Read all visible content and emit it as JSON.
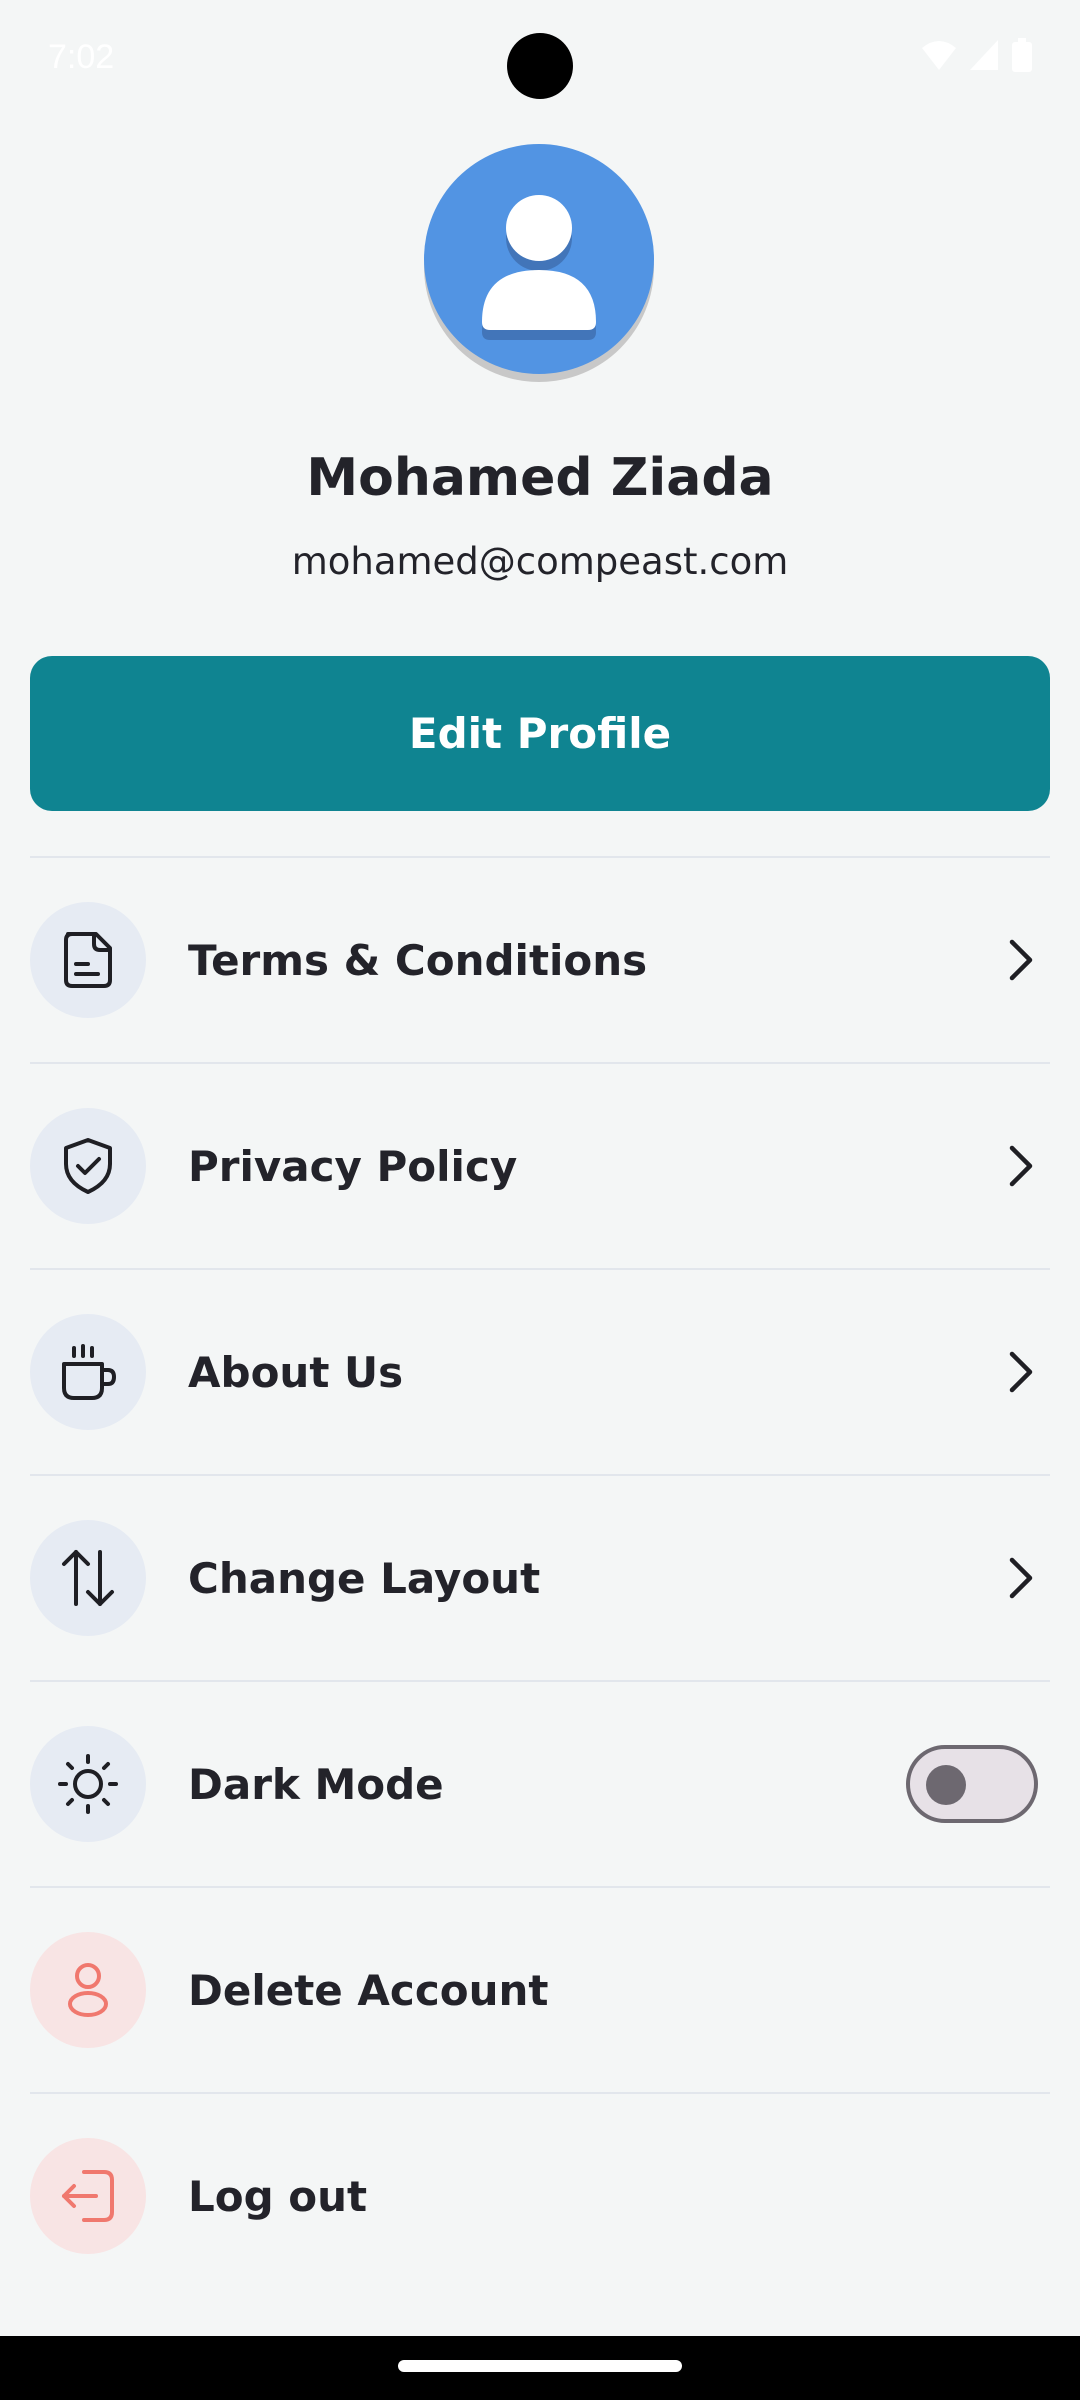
{
  "status_bar": {
    "time": "7:02"
  },
  "profile": {
    "name": "Mohamed Ziada",
    "email": "mohamed@compeast.com",
    "edit_button": "Edit Profile"
  },
  "menu": {
    "items": [
      {
        "label": "Terms & Conditions",
        "icon": "document-icon"
      },
      {
        "label": "Privacy Policy",
        "icon": "shield-check-icon"
      },
      {
        "label": "About Us",
        "icon": "coffee-cup-icon"
      },
      {
        "label": "Change Layout",
        "icon": "sort-arrows-icon"
      },
      {
        "label": "Dark Mode",
        "icon": "sun-icon",
        "toggle_on": false
      },
      {
        "label": "Delete Account",
        "icon": "user-icon"
      },
      {
        "label": "Log out",
        "icon": "logout-icon"
      }
    ]
  },
  "colors": {
    "accent": "#0f8491",
    "background": "#f4f6f6",
    "avatar": "#5294e3",
    "danger": "#f0786e"
  }
}
